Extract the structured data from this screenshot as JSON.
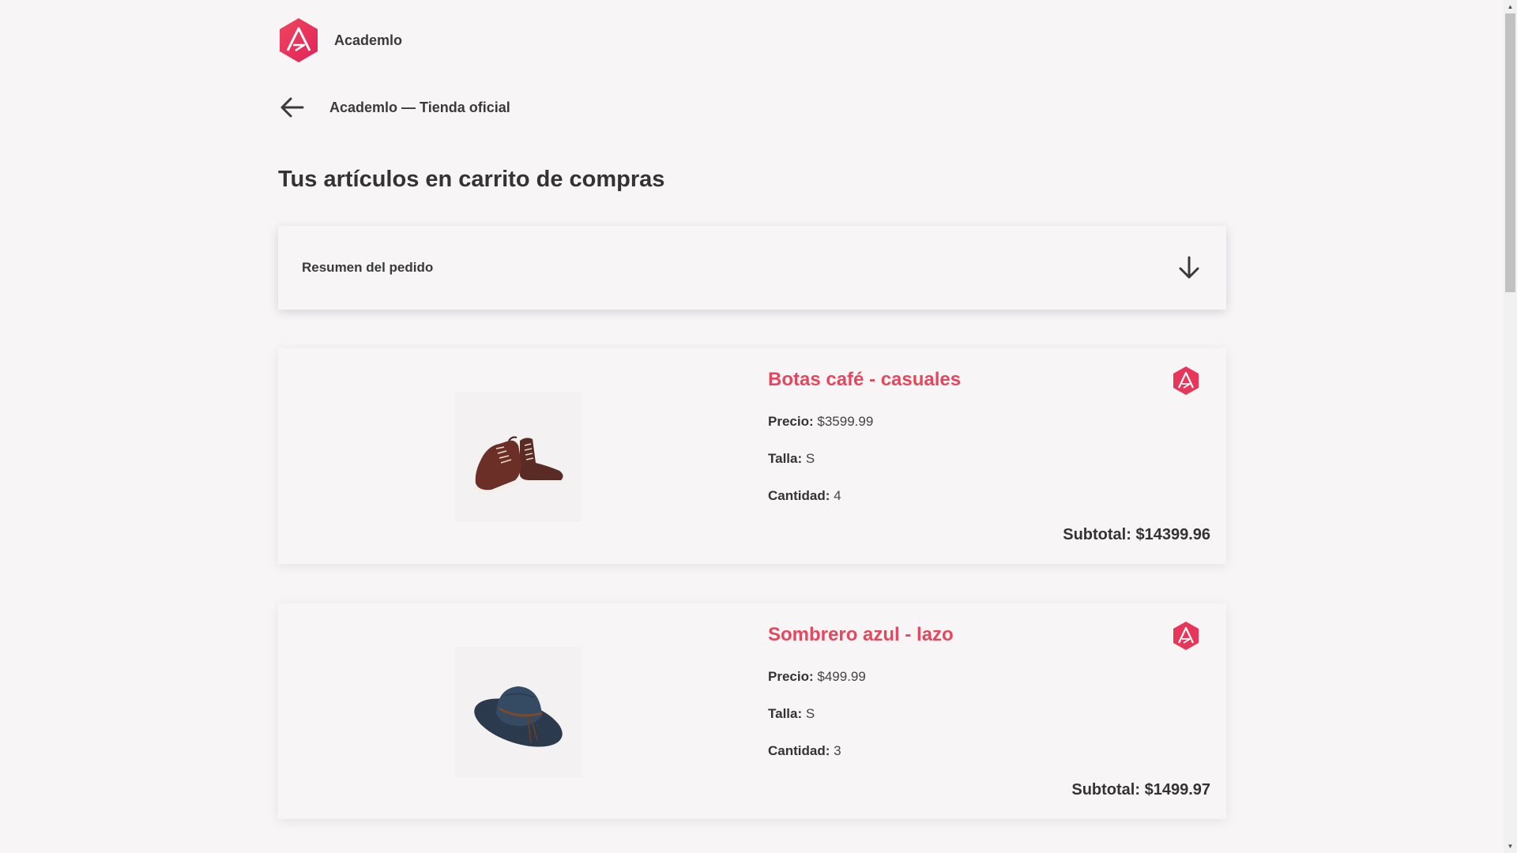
{
  "header": {
    "brand_name": "Academlo",
    "logo_icon": "academlo-logo-icon",
    "brand_color": "#e8305a"
  },
  "nav": {
    "back_icon": "arrow-left-icon",
    "store_link": "Academlo — Tienda oficial"
  },
  "page": {
    "title": "Tus artículos en carrito de compras"
  },
  "summary": {
    "label": "Resumen del pedido",
    "toggle_icon": "arrow-down-icon"
  },
  "labels": {
    "price": "Precio:",
    "size": "Talla:",
    "quantity": "Cantidad:",
    "subtotal": "Subtotal:"
  },
  "cart": {
    "items": [
      {
        "name": "Botas café - casuales",
        "price": "$3599.99",
        "size": "S",
        "quantity": "4",
        "subtotal": "$14399.96",
        "image_icon": "brown-boots-image",
        "badge_icon": "academlo-logo-icon"
      },
      {
        "name": "Sombrero azul - lazo",
        "price": "$499.99",
        "size": "S",
        "quantity": "3",
        "subtotal": "$1499.97",
        "image_icon": "blue-hat-image",
        "badge_icon": "academlo-logo-icon"
      }
    ]
  },
  "colors": {
    "background": "#f7f5f6",
    "product_name": "#e4485f",
    "text": "#3a3a3a"
  }
}
